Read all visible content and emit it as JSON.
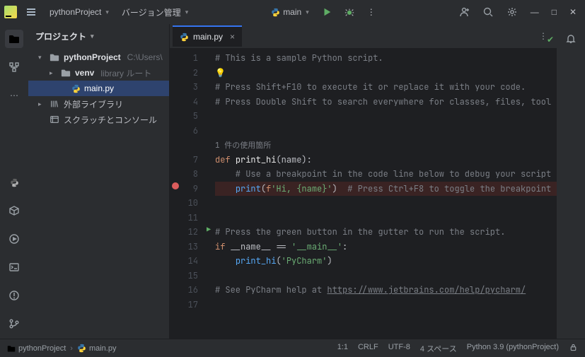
{
  "titlebar": {
    "project": "pythonProject",
    "vcs": "バージョン管理",
    "run_config": "main",
    "actions": {
      "run": "Run",
      "debug": "Debug",
      "more": "More",
      "code_with_me": "Code With Me",
      "search": "Search",
      "settings": "Settings",
      "minimize": "—",
      "maximize": "□",
      "close": "✕"
    }
  },
  "project_panel": {
    "title": "プロジェクト"
  },
  "tree": {
    "root": {
      "name": "pythonProject",
      "path": "C:\\Users\\"
    },
    "venv": {
      "name": "venv",
      "hint": "library ルート"
    },
    "mainpy": "main.py",
    "ext_lib": "外部ライブラリ",
    "scratch": "スクラッチとコンソール"
  },
  "leftstrip": {
    "project": "Project",
    "structure": "Structure",
    "more": "More",
    "python_console": "Python Console",
    "packages": "Python Packages",
    "services": "Services",
    "terminal": "Terminal",
    "problems": "Problems",
    "vcs": "Version Control"
  },
  "tabs": {
    "items": [
      {
        "label": "main.py"
      }
    ],
    "more": "⋮",
    "notifications": "Notifications"
  },
  "editor": {
    "usages_hint": "1 件の使用箇所",
    "lines": {
      "1": "# This is a sample Python script.",
      "3": "# Press Shift+F10 to execute it or replace it with your code.",
      "4": "# Press Double Shift to search everywhere for classes, files, tool",
      "7_def": "def ",
      "7_name": "print_hi",
      "7_par": "(name):",
      "8": "    # Use a breakpoint in the code line below to debug your script",
      "9_ind": "    ",
      "9_print": "print",
      "9_open": "(",
      "9_f": "f",
      "9_str": "'Hi, {name}'",
      "9_close": ")",
      "9_cm": "  # Press Ctrl+F8 to toggle the breakpoint",
      "11": "# Press the green button in the gutter to run the script.",
      "12_if": "if ",
      "12_name": "__name__",
      "12_eq": " == ",
      "12_main": "'__main__'",
      "12_colon": ":",
      "13_ind": "    ",
      "13_call": "print_hi",
      "13_open": "(",
      "13_arg": "'PyCharm'",
      "13_close": ")",
      "16_cm": "# See PyCharm help at ",
      "16_url": "https://www.jetbrains.com/help/pycharm/"
    },
    "line_numbers": [
      "1",
      "2",
      "3",
      "4",
      "5",
      "6",
      "",
      "7",
      "8",
      "9",
      "10",
      "11",
      "12",
      "13",
      "14",
      "15",
      "16",
      "17"
    ]
  },
  "statusbar": {
    "breadcrumb_proj": "pythonProject",
    "breadcrumb_file": "main.py",
    "caret": "1:1",
    "eol": "CRLF",
    "encoding": "UTF-8",
    "indent": "4 スペース",
    "interpreter": "Python 3.9 (pythonProject)",
    "lock": "Read-Only"
  }
}
